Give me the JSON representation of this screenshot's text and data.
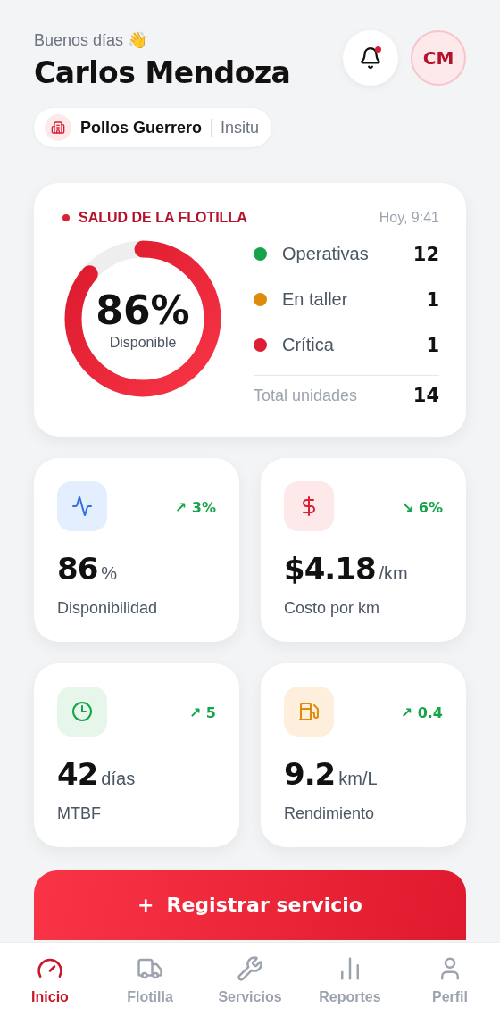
{
  "header": {
    "greeting": "Buenos días 👋",
    "name": "Carlos Mendoza",
    "notifications": {
      "unread": true
    },
    "avatar": "CM",
    "company": {
      "name": "Pollos Guerrero",
      "branch": "Insitu"
    }
  },
  "fleet_health": {
    "title": "SALUD DE LA FLOTILLA",
    "time": "Hoy, 9:41",
    "gauge": {
      "value": "86%",
      "label": "Disponible",
      "level": 0.86
    },
    "statuses": [
      {
        "label": "Operativas",
        "count": "12",
        "color": "#16a34a"
      },
      {
        "label": "En taller",
        "count": "1",
        "color": "#e08a0b"
      },
      {
        "label": "Crítica",
        "count": "1",
        "color": "#dc1f35"
      }
    ],
    "total": {
      "label": "Total unidades",
      "count": "14"
    }
  },
  "metrics": [
    {
      "kind": "availability",
      "value": "86",
      "unit": "%",
      "label": "Disponibilidad",
      "trend": "↗ 3%"
    },
    {
      "kind": "cost",
      "value": "$4.18",
      "unit": "/km",
      "label": "Costo por km",
      "trend": "↘ 6%"
    },
    {
      "kind": "reliability",
      "value": "42",
      "unit": "días",
      "label": "MTBF",
      "trend": "↗ 5"
    },
    {
      "kind": "efficiency",
      "value": "9.2",
      "unit": "km/L",
      "label": "Rendimiento",
      "trend": "↗ 0.4"
    }
  ],
  "primary_action": {
    "icon": "+",
    "label": "Registrar servicio"
  },
  "bottom_nav": [
    {
      "kind": "home",
      "label": "Inicio",
      "selected": true
    },
    {
      "kind": "fleet",
      "label": "Flotilla",
      "selected": false
    },
    {
      "kind": "services",
      "label": "Servicios",
      "selected": false
    },
    {
      "kind": "reports",
      "label": "Reportes",
      "selected": false
    },
    {
      "kind": "profile",
      "label": "Perfil",
      "selected": false
    }
  ]
}
